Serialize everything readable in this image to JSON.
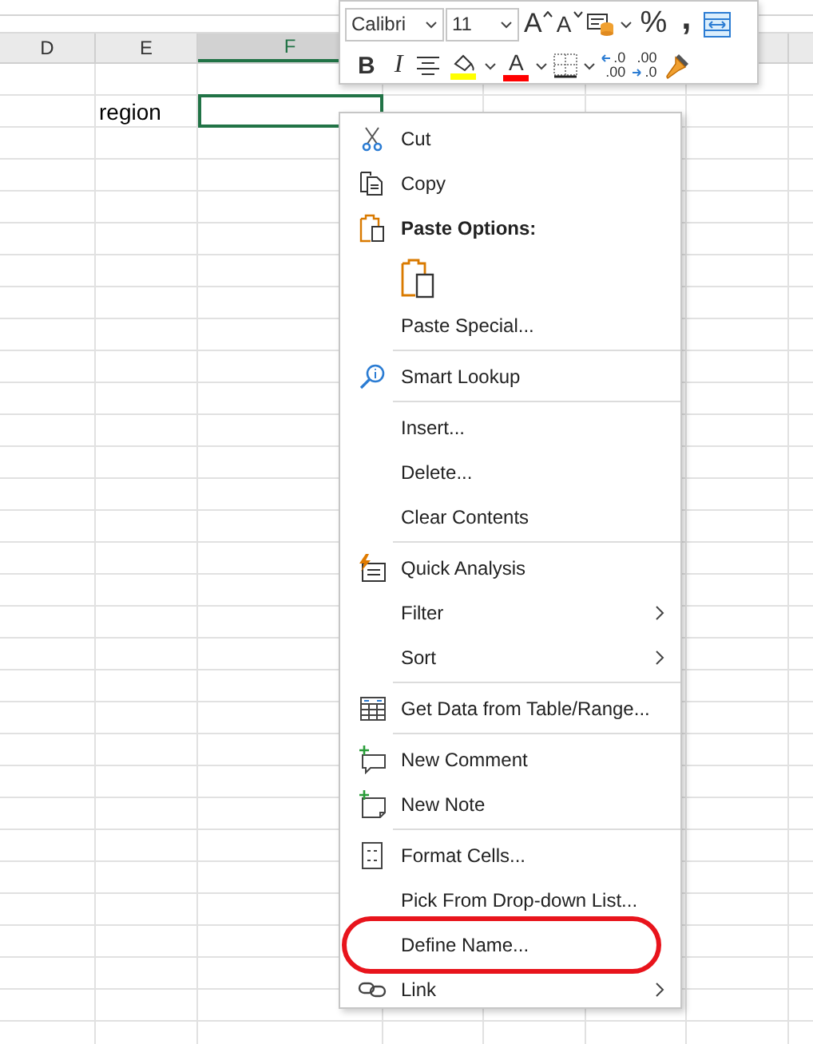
{
  "sheet": {
    "columns": [
      {
        "label": "D",
        "selected": false
      },
      {
        "label": "E",
        "selected": false
      },
      {
        "label": "F",
        "selected": true
      }
    ],
    "rows": [
      {
        "cells": [
          {
            "selected": false
          },
          {
            "text": "region",
            "selected": false
          },
          {
            "selected": true
          }
        ]
      }
    ]
  },
  "mini_toolbar": {
    "top_row": [
      {
        "kind": "font",
        "value": "Calibri"
      },
      {
        "kind": "size",
        "value": "11"
      },
      {
        "kind": "grow",
        "label": "A"
      },
      {
        "kind": "shrink",
        "label": "A"
      },
      {
        "kind": "number-format"
      },
      {
        "kind": "caret"
      },
      {
        "kind": "percent",
        "label": "%"
      },
      {
        "kind": "comma",
        "label": ","
      },
      {
        "kind": "wrap"
      }
    ],
    "bottom_row": [
      {
        "kind": "bold",
        "label": "B"
      },
      {
        "kind": "italic",
        "label": "I"
      },
      {
        "kind": "align"
      },
      {
        "kind": "fill-color",
        "color": "#ffff00"
      },
      {
        "kind": "caret"
      },
      {
        "kind": "font-color",
        "label": "A",
        "color": "#ff0000"
      },
      {
        "kind": "caret"
      },
      {
        "kind": "borders"
      },
      {
        "kind": "caret"
      },
      {
        "kind": "inc-decimal",
        "top": ".0",
        "bottom": ".00"
      },
      {
        "kind": "dec-decimal",
        "top": ".00",
        "bottom": ".0"
      },
      {
        "kind": "painter"
      }
    ]
  },
  "menu": {
    "items": [
      {
        "kind": "cut",
        "label": "Cut",
        "submenu": false,
        "highlighted": false
      },
      {
        "kind": "copy",
        "label": "Copy",
        "submenu": false,
        "highlighted": false
      },
      {
        "kind": "paste-header",
        "label": "Paste Options:"
      },
      {
        "kind": "paste-icons"
      },
      {
        "kind": "command",
        "label": "Paste Special...",
        "submenu": false,
        "highlighted": false
      },
      {
        "kind": "separator"
      },
      {
        "kind": "lookup",
        "label": "Smart Lookup",
        "submenu": false,
        "highlighted": false
      },
      {
        "kind": "separator"
      },
      {
        "kind": "command",
        "label": "Insert...",
        "submenu": false,
        "highlighted": false
      },
      {
        "kind": "command",
        "label": "Delete...",
        "submenu": false,
        "highlighted": false
      },
      {
        "kind": "command",
        "label": "Clear Contents",
        "submenu": false,
        "highlighted": false
      },
      {
        "kind": "separator"
      },
      {
        "kind": "analysis",
        "label": "Quick Analysis",
        "submenu": false,
        "highlighted": false
      },
      {
        "kind": "command",
        "label": "Filter",
        "submenu": true,
        "highlighted": false
      },
      {
        "kind": "command",
        "label": "Sort",
        "submenu": true,
        "highlighted": false
      },
      {
        "kind": "separator"
      },
      {
        "kind": "table",
        "label": "Get Data from Table/Range...",
        "submenu": false,
        "highlighted": false
      },
      {
        "kind": "separator"
      },
      {
        "kind": "comment",
        "label": "New Comment",
        "submenu": false,
        "highlighted": false
      },
      {
        "kind": "note",
        "label": "New Note",
        "submenu": false,
        "highlighted": false
      },
      {
        "kind": "separator"
      },
      {
        "kind": "format",
        "label": "Format Cells...",
        "submenu": false,
        "highlighted": false
      },
      {
        "kind": "command",
        "label": "Pick From Drop-down List...",
        "submenu": false,
        "highlighted": false
      },
      {
        "kind": "command",
        "label": "Define Name...",
        "submenu": false,
        "highlighted": true
      },
      {
        "kind": "link",
        "label": "Link",
        "submenu": true,
        "highlighted": false
      }
    ]
  }
}
